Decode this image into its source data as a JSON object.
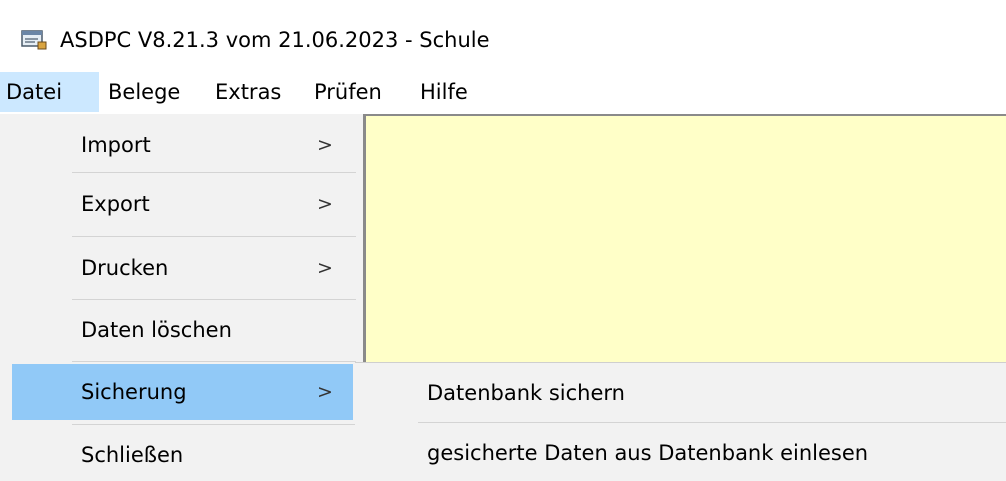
{
  "window": {
    "title": "ASDPC V8.21.3 vom 21.06.2023 - Schule",
    "icon": "app-icon"
  },
  "menubar": {
    "items": [
      {
        "label": "Datei",
        "active": true
      },
      {
        "label": "Belege"
      },
      {
        "label": "Extras"
      },
      {
        "label": "Prüfen"
      },
      {
        "label": "Hilfe"
      }
    ]
  },
  "datei_menu": {
    "items": [
      {
        "label": "Import",
        "arrow": ">"
      },
      {
        "label": "Export",
        "arrow": ">"
      },
      {
        "label": "Drucken",
        "arrow": ">"
      },
      {
        "label": "Daten löschen"
      },
      {
        "label": "Sicherung",
        "arrow": ">",
        "highlighted": true
      },
      {
        "label": "Schließen"
      }
    ]
  },
  "sicherung_submenu": {
    "items": [
      {
        "label": "Datenbank sichern"
      },
      {
        "label": "gesicherte Daten aus Datenbank einlesen"
      }
    ]
  },
  "colors": {
    "client_background": "#ffffc8",
    "menu_background": "#f2f2f2",
    "highlight": "#91c9f7",
    "menubar_active": "#cce8ff"
  }
}
